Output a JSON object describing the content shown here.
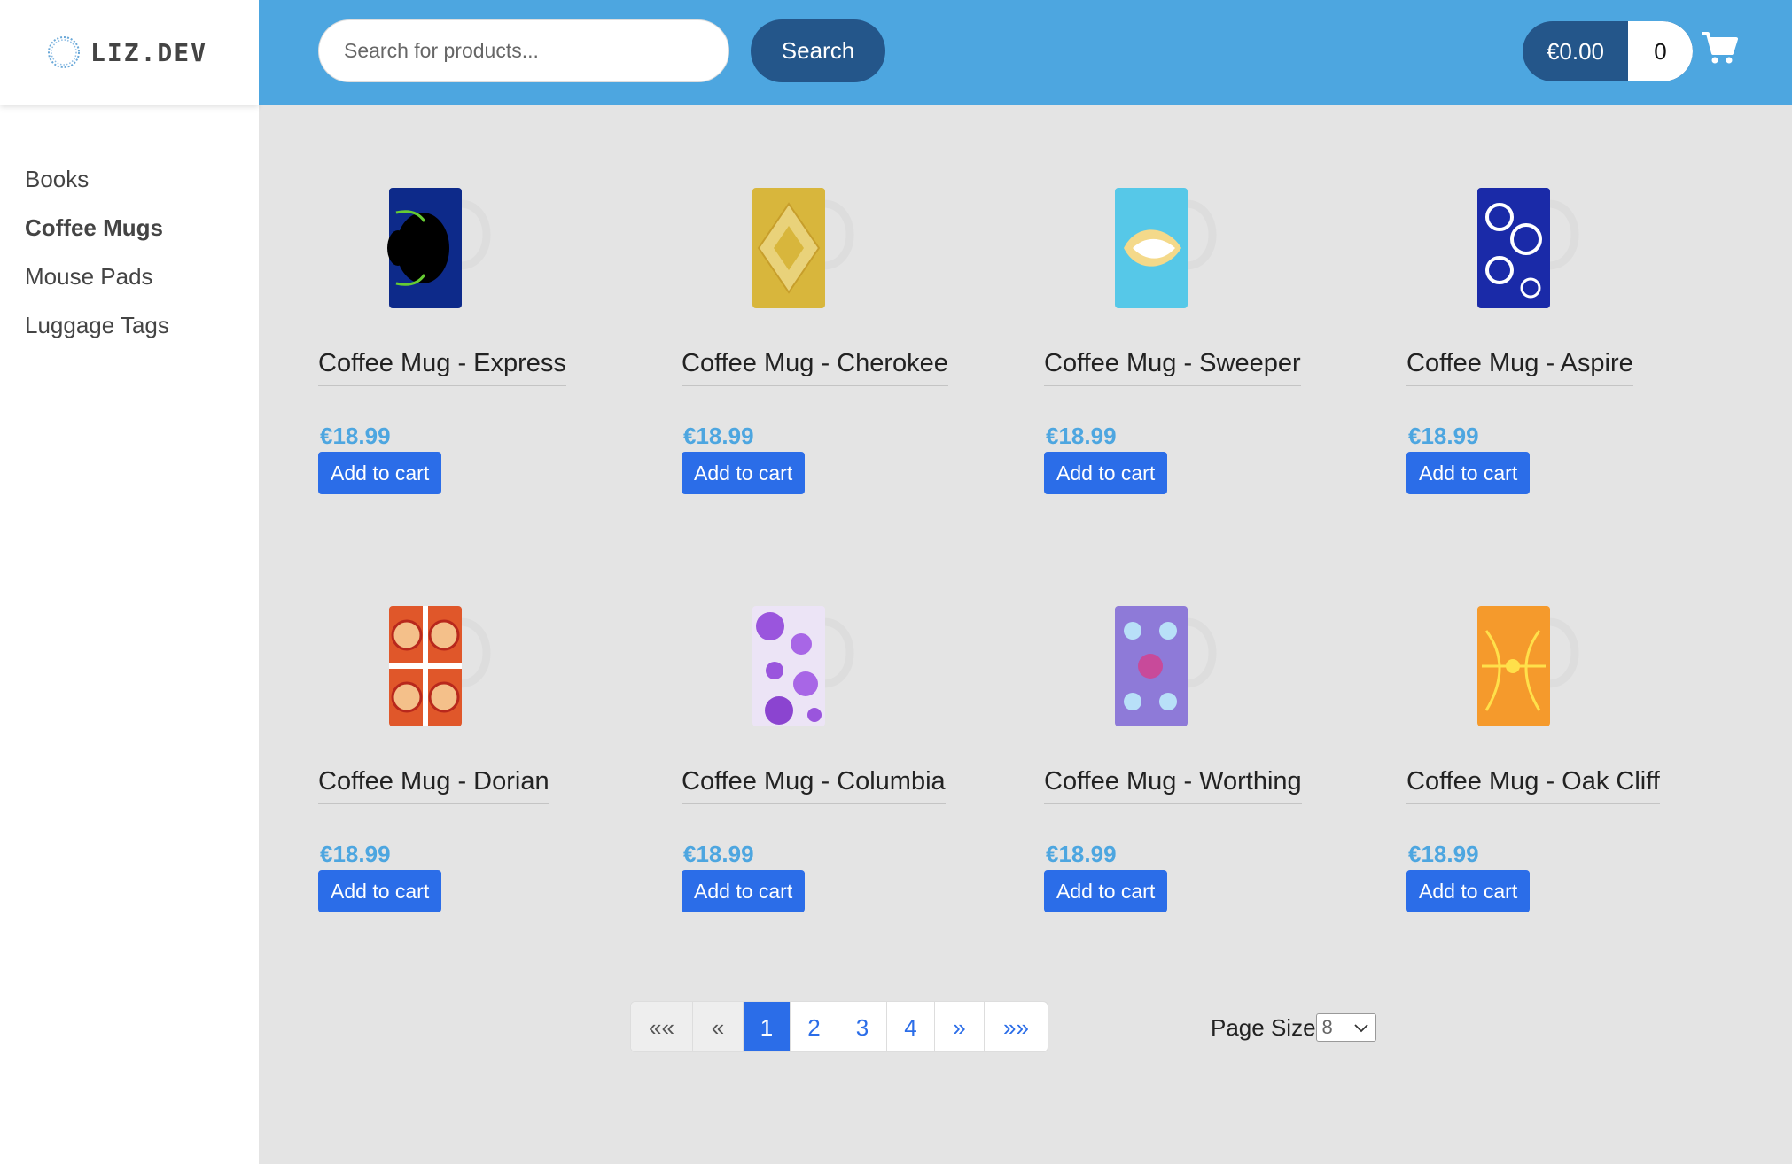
{
  "logo": {
    "text": "LIZ.DEV"
  },
  "nav": {
    "items": [
      "Books",
      "Coffee Mugs",
      "Mouse Pads",
      "Luggage Tags"
    ],
    "active": "Coffee Mugs"
  },
  "search": {
    "placeholder": "Search for products...",
    "button_label": "Search"
  },
  "cart": {
    "total": "€0.00",
    "count": "0",
    "icon": "shopping-cart-icon"
  },
  "products": [
    {
      "title": "Coffee Mug - Express",
      "price": "€18.99",
      "button_label": "Add to cart"
    },
    {
      "title": "Coffee Mug - Cherokee",
      "price": "€18.99",
      "button_label": "Add to cart"
    },
    {
      "title": "Coffee Mug - Sweeper",
      "price": "€18.99",
      "button_label": "Add to cart"
    },
    {
      "title": "Coffee Mug - Aspire",
      "price": "€18.99",
      "button_label": "Add to cart"
    },
    {
      "title": "Coffee Mug - Dorian",
      "price": "€18.99",
      "button_label": "Add to cart"
    },
    {
      "title": "Coffee Mug - Columbia",
      "price": "€18.99",
      "button_label": "Add to cart"
    },
    {
      "title": "Coffee Mug - Worthing",
      "price": "€18.99",
      "button_label": "Add to cart"
    },
    {
      "title": "Coffee Mug - Oak Cliff",
      "price": "€18.99",
      "button_label": "Add to cart"
    }
  ],
  "pagination": {
    "first": "««",
    "prev": "«",
    "pages": [
      "1",
      "2",
      "3",
      "4"
    ],
    "current": "1",
    "next": "»",
    "last": "»»"
  },
  "page_size": {
    "label": "Page Size",
    "value": "8"
  },
  "colors": {
    "header": "#4da6e0",
    "dark_button": "#24568a",
    "primary_button": "#2b6de8",
    "price": "#4da6e0",
    "background": "#e4e4e4"
  }
}
